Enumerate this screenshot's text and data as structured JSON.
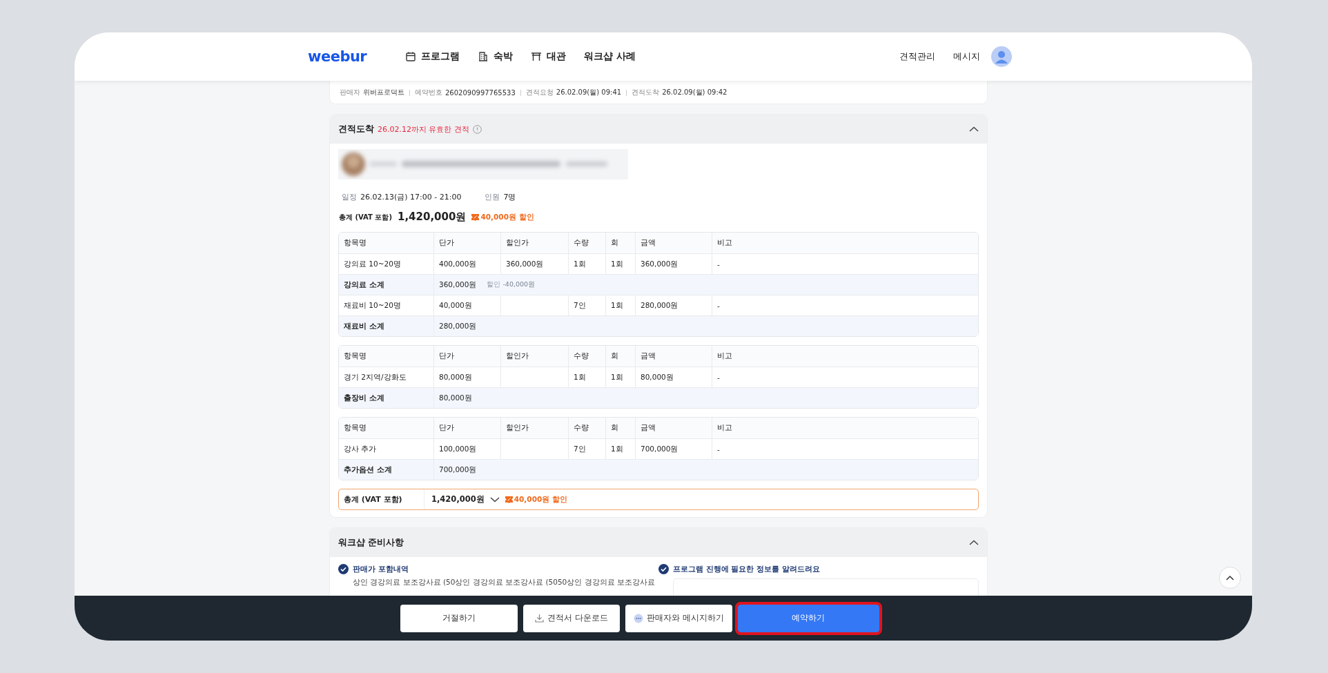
{
  "header": {
    "logo": "weebur",
    "nav": [
      {
        "label": "프로그램"
      },
      {
        "label": "숙박"
      },
      {
        "label": "대관"
      },
      {
        "label": "워크샵 사례"
      }
    ],
    "links": [
      "견적관리",
      "메시지"
    ]
  },
  "meta": [
    {
      "label": "판매자",
      "value": "위버프로덕트"
    },
    {
      "label": "예약번호",
      "value": "2602090997765533"
    },
    {
      "label": "견적요청",
      "value": "26.02.09(월) 09:41"
    },
    {
      "label": "견적도착",
      "value": "26.02.09(월) 09:42"
    }
  ],
  "quote": {
    "title": "견적도착",
    "validity": "26.02.12까지 유효한 견적",
    "expanded": true,
    "schedule": {
      "label": "일정",
      "value": "26.02.13(금) 17:00 - 21:00"
    },
    "people": {
      "label": "인원",
      "value": "7명"
    },
    "total": {
      "label": "총계 (VAT 포함)",
      "value": "1,420,000원",
      "discount": "40,000원 할인"
    },
    "tables": [
      {
        "columns": [
          "항목명",
          "단가",
          "할인가",
          "수량",
          "회",
          "금액",
          "비고"
        ],
        "rows": [
          {
            "kind": "item",
            "cells": [
              "강의료 10~20명",
              "400,000원",
              "360,000원",
              "1회",
              "1회",
              "360,000원",
              "-"
            ]
          },
          {
            "kind": "subtotal",
            "label": "강의료 소계",
            "amount": "360,000원",
            "note_label": "할인",
            "note_value": "-40,000원"
          },
          {
            "kind": "item",
            "cells": [
              "재료비 10~20명",
              "40,000원",
              "",
              "7인",
              "1회",
              "280,000원",
              "-"
            ]
          },
          {
            "kind": "subtotal",
            "label": "재료비 소계",
            "amount": "280,000원"
          }
        ]
      },
      {
        "columns": [
          "항목명",
          "단가",
          "할인가",
          "수량",
          "회",
          "금액",
          "비고"
        ],
        "rows": [
          {
            "kind": "item",
            "cells": [
              "경기 2지역/강화도",
              "80,000원",
              "",
              "1회",
              "1회",
              "80,000원",
              "-"
            ]
          },
          {
            "kind": "subtotal",
            "label": "출장비 소계",
            "amount": "80,000원"
          }
        ]
      },
      {
        "columns": [
          "항목명",
          "단가",
          "할인가",
          "수량",
          "회",
          "금액",
          "비고"
        ],
        "rows": [
          {
            "kind": "item",
            "cells": [
              "강사 추가",
              "100,000원",
              "",
              "7인",
              "1회",
              "700,000원",
              "-"
            ]
          },
          {
            "kind": "subtotal",
            "label": "추가옵션 소계",
            "amount": "700,000원"
          }
        ]
      }
    ],
    "grand_total": {
      "label": "총계 (VAT 포함)",
      "value": "1,420,000원",
      "discount": "40,000원 할인",
      "expanded": false
    }
  },
  "prep": {
    "title": "워크샵 준비사항",
    "expanded": true,
    "left": {
      "title": "판매가 포함내역",
      "text": "상인 경강의료 보조강사료 (50상인 경강의료 보조강사료 (5050상인 경강의료 보조강사료"
    },
    "right": {
      "title": "프로그램 진행에 필요한 정보를 알려드려요"
    }
  },
  "footer": [
    {
      "label": "거절하기",
      "kind": "plain",
      "highlighted": false
    },
    {
      "label": "견적서 다운로드",
      "kind": "plain",
      "highlighted": false
    },
    {
      "label": "판매자와 메시지하기",
      "kind": "plain",
      "highlighted": false
    },
    {
      "label": "예약하기",
      "kind": "primary",
      "highlighted": true
    }
  ]
}
